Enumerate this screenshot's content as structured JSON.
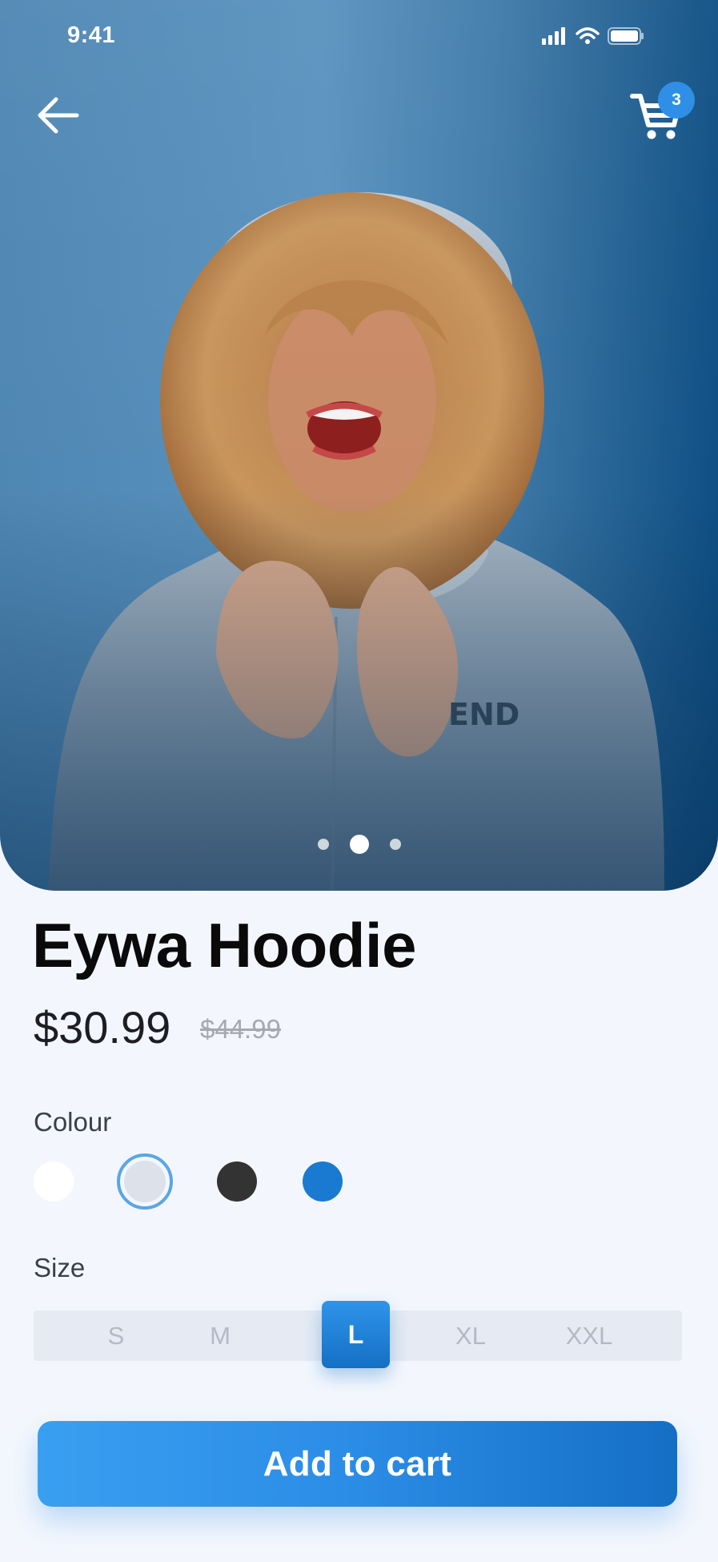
{
  "status_bar": {
    "time": "9:41"
  },
  "header": {
    "cart_count": "3"
  },
  "product": {
    "name": "Eywa Hoodie",
    "price": "$30.99",
    "old_price": "$44.99"
  },
  "gallery": {
    "total_images": 3,
    "active_index": 1
  },
  "colour": {
    "label": "Colour",
    "options": [
      "#ffffff",
      "#dde1ea",
      "#333333",
      "#1a7ad2"
    ],
    "selected_index": 1
  },
  "size": {
    "label": "Size",
    "options": [
      "S",
      "M",
      "L",
      "XL",
      "XXL"
    ],
    "selected": "L"
  },
  "cta": {
    "label": "Add to cart"
  },
  "colors": {
    "accent": "#2b8ce6",
    "background": "#f3f7fd"
  }
}
